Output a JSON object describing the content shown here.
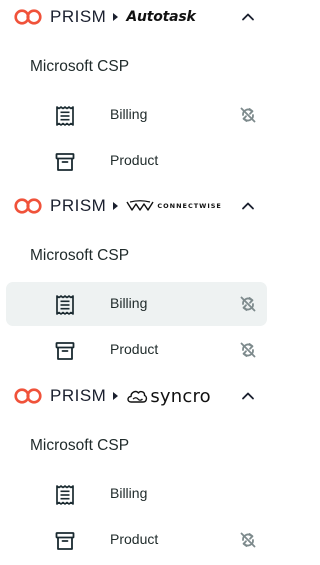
{
  "brand": {
    "name": "PRISM"
  },
  "groups": [
    {
      "vendor_text": "Autotask",
      "section_title": "Microsoft CSP",
      "items": [
        {
          "label": "Billing",
          "icon": "receipt-icon",
          "sync_disabled": true
        },
        {
          "label": "Product",
          "icon": "archive-box-icon",
          "sync_disabled": false
        }
      ]
    },
    {
      "vendor_text": "CONNECTWISE",
      "section_title": "Microsoft CSP",
      "items": [
        {
          "label": "Billing",
          "icon": "receipt-icon",
          "sync_disabled": true,
          "active": true
        },
        {
          "label": "Product",
          "icon": "archive-box-icon",
          "sync_disabled": true
        }
      ]
    },
    {
      "vendor_text": "syncro",
      "section_title": "Microsoft CSP",
      "items": [
        {
          "label": "Billing",
          "icon": "receipt-icon",
          "sync_disabled": false
        },
        {
          "label": "Product",
          "icon": "archive-box-icon",
          "sync_disabled": true
        }
      ]
    }
  ],
  "colors": {
    "prism_accent": "#f0523a",
    "icon_dark": "#1a2a30",
    "sync_gray": "#7d8a8c",
    "active_row_bg": "#eef2f2"
  }
}
